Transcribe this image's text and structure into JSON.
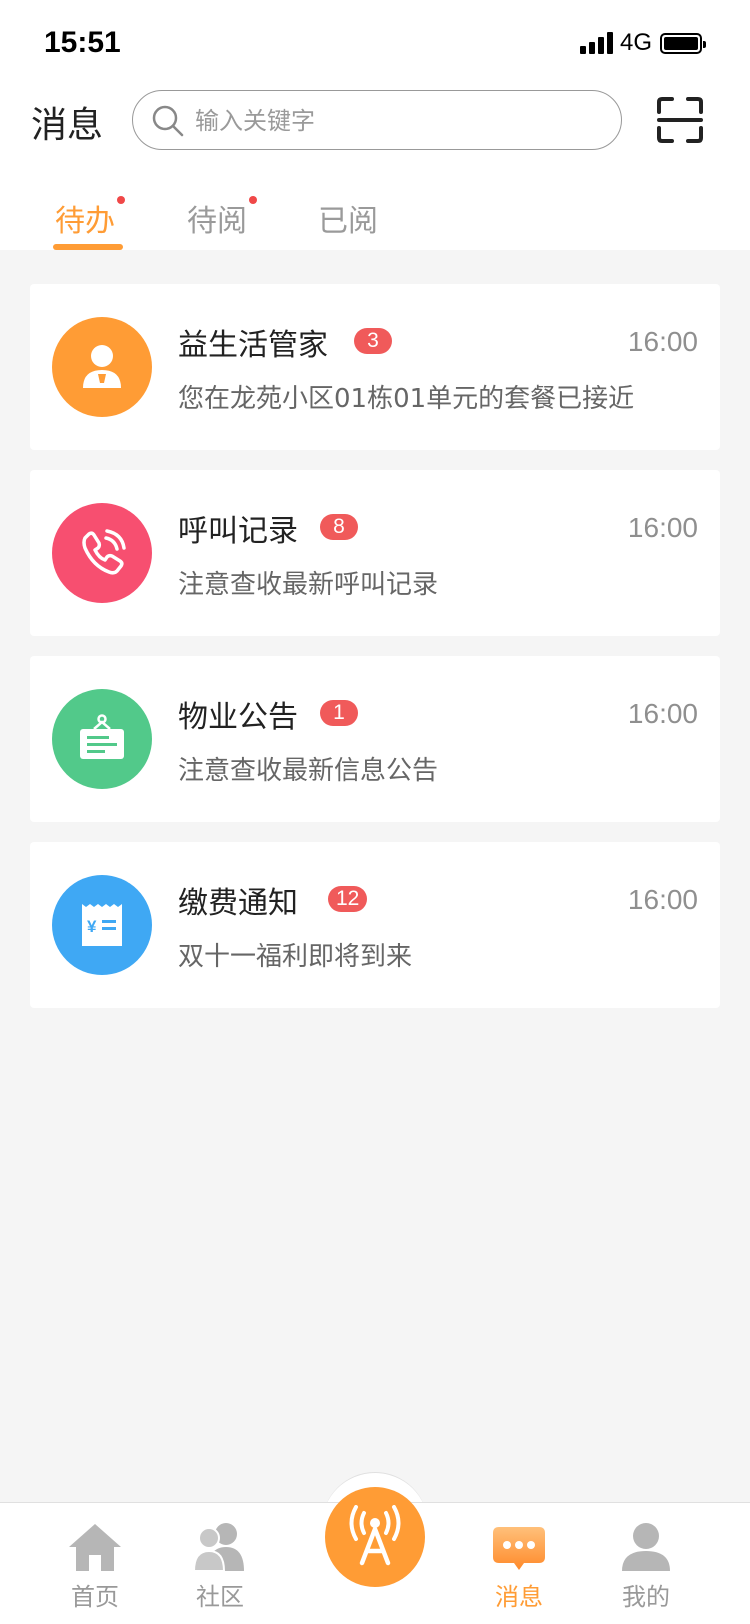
{
  "status_bar": {
    "time": "15:51",
    "network": "4G"
  },
  "header": {
    "title": "消息",
    "search": {
      "placeholder": "输入关键字",
      "value": ""
    },
    "scan_icon": "scan-icon"
  },
  "tabs": [
    {
      "label": "待办",
      "active": true,
      "dot": true
    },
    {
      "label": "待阅",
      "active": false,
      "dot": true
    },
    {
      "label": "已阅",
      "active": false,
      "dot": false
    }
  ],
  "messages": [
    {
      "title": "益生活管家",
      "badge": "3",
      "time": "16:00",
      "desc": "您在龙苑小区01栋01单元的套餐已接近",
      "icon": "user-icon",
      "color": "#ff9c35"
    },
    {
      "title": "呼叫记录",
      "badge": "8",
      "time": "16:00",
      "desc": "注意查收最新呼叫记录",
      "icon": "phone-icon",
      "color": "#f74f70"
    },
    {
      "title": "物业公告",
      "badge": "1",
      "time": "16:00",
      "desc": "注意查收最新信息公告",
      "icon": "notice-board-icon",
      "color": "#52c98a"
    },
    {
      "title": "缴费通知",
      "badge": "12",
      "time": "16:00",
      "desc": "双十一福利即将到来",
      "icon": "bill-icon",
      "color": "#3fa8f4"
    }
  ],
  "tabbar": {
    "items": [
      {
        "label": "首页",
        "icon": "home-icon",
        "active": false
      },
      {
        "label": "社区",
        "icon": "community-icon",
        "active": false
      },
      {
        "label": "",
        "icon": "broadcast-antenna-icon",
        "active": false
      },
      {
        "label": "消息",
        "icon": "message-icon",
        "active": true
      },
      {
        "label": "我的",
        "icon": "profile-icon",
        "active": false
      }
    ]
  },
  "colors": {
    "accent": "#ff9c35",
    "badge": "#f05a5a",
    "dot": "#f04848"
  }
}
